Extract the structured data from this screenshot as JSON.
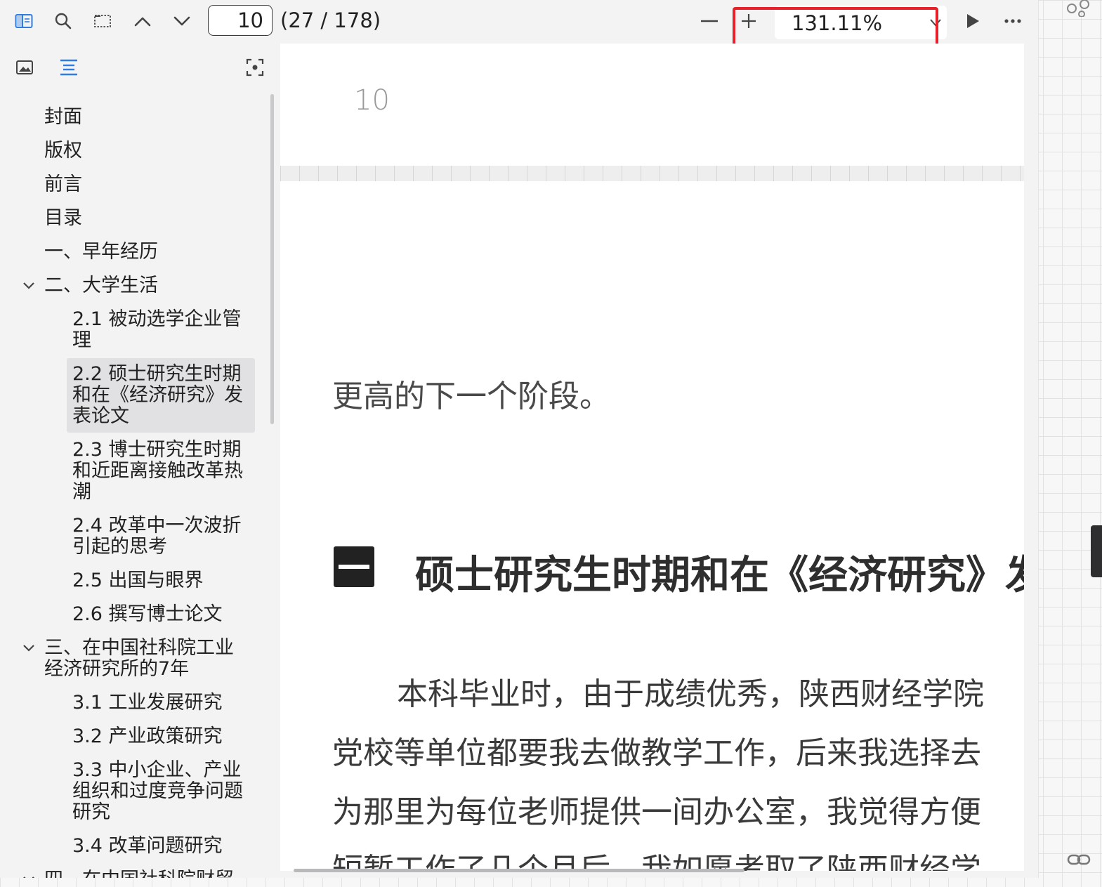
{
  "toolbar": {
    "page_input_value": "10",
    "page_count": "(27 / 178)",
    "zoom_value": "131.11%"
  },
  "toc": {
    "items": [
      {
        "label": "封面"
      },
      {
        "label": "版权"
      },
      {
        "label": "前言"
      },
      {
        "label": "目录"
      },
      {
        "label": "一、早年经历"
      },
      {
        "label": "二、大学生活"
      },
      {
        "label": "2.1 被动选学企业管理"
      },
      {
        "label": "2.2 硕士研究生时期和在《经济研究》发表论文"
      },
      {
        "label": "2.3 博士研究生时期和近距离接触改革热潮"
      },
      {
        "label": "2.4 改革中一次波折引起的思考"
      },
      {
        "label": "2.5 出国与眼界"
      },
      {
        "label": "2.6 撰写博士论文"
      },
      {
        "label": "三、在中国社科院工业经济研究所的7年"
      },
      {
        "label": "3.1 工业发展研究"
      },
      {
        "label": "3.2 产业政策研究"
      },
      {
        "label": "3.3 中小企业、产业组织和过度竞争问题研究"
      },
      {
        "label": "3.4 改革问题研究"
      },
      {
        "label": "四、在中国社科院财贸"
      }
    ]
  },
  "document": {
    "page_number": "10",
    "line_prev": "更高的下一个阶段。",
    "section_title": "硕士研究生时期和在《经济研究》发",
    "para": [
      "本科毕业时，由于成绩优秀，陕西财经学院",
      "党校等单位都要我去做教学工作，后来我选择去",
      "为那里为每位老师提供一间办公室，我觉得方便",
      "短暂工作了几个月后，我如愿考取了陕西财经学"
    ]
  },
  "colors": {
    "accent": "#2f7de1",
    "highlight": "#e8202a"
  },
  "icons": {
    "sidebar_toggle": "sidebar-toggle-icon",
    "search": "search-icon",
    "select": "area-select-icon",
    "prev": "chevron-up-icon",
    "next": "chevron-down-icon",
    "zoom_out": "minus-icon",
    "zoom_in": "plus-icon",
    "play": "play-icon",
    "more": "more-icon"
  }
}
